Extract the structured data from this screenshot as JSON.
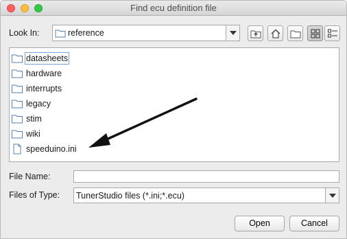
{
  "window": {
    "title": "Find ecu definition file"
  },
  "look_in": {
    "label": "Look In:",
    "value": "reference"
  },
  "toolbar": {
    "icons": [
      "up-one-level-icon",
      "home-icon",
      "new-folder-icon",
      "list-view-icon",
      "details-view-icon"
    ],
    "active_view": "list-view"
  },
  "files": [
    {
      "name": "datasheets",
      "type": "folder"
    },
    {
      "name": "hardware",
      "type": "folder"
    },
    {
      "name": "interrupts",
      "type": "folder"
    },
    {
      "name": "legacy",
      "type": "folder"
    },
    {
      "name": "stim",
      "type": "folder"
    },
    {
      "name": "wiki",
      "type": "folder"
    },
    {
      "name": "speeduino.ini",
      "type": "file"
    }
  ],
  "file_name": {
    "label": "File Name:",
    "value": ""
  },
  "file_type": {
    "label": "Files of Type:",
    "value": "TunerStudio files (*.ini;*.ecu)"
  },
  "buttons": {
    "open": "Open",
    "cancel": "Cancel"
  },
  "colors": {
    "close": "#fc605c",
    "minimize": "#fdbc40",
    "maximize": "#34c84a",
    "selection_outline": "#7aa6d6"
  }
}
